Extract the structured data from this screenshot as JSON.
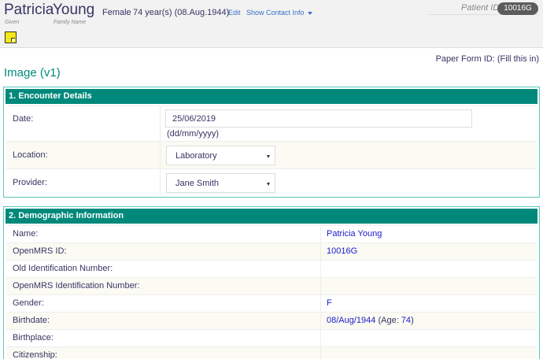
{
  "patient": {
    "given_name": "Patricia",
    "family_name": "Young",
    "given_label": "Given",
    "family_label": "Family Name",
    "gender": "Female",
    "age": "74 year(s) (08.Aug.1944)",
    "edit_label": "Edit",
    "contact_label": "Show Contact Info",
    "patient_id_label": "Patient ID",
    "patient_id": "10016G"
  },
  "form": {
    "paper_form_id": "Paper Form ID: (Fill this in)",
    "title": "Image (v1)"
  },
  "encounter": {
    "header": "1. Encounter Details",
    "date_label": "Date:",
    "date_value": "25/06/2019",
    "date_hint": "(dd/mm/yyyy)",
    "location_label": "Location:",
    "location_value": "Laboratory",
    "provider_label": "Provider:",
    "provider_value": "Jane Smith"
  },
  "demographics": {
    "header": "2. Demographic Information",
    "rows": [
      {
        "label": "Name:",
        "value": "Patricia Young"
      },
      {
        "label": "OpenMRS ID:",
        "value": "10016G"
      },
      {
        "label": "Old Identification Number:",
        "value": ""
      },
      {
        "label": "OpenMRS Identification Number:",
        "value": ""
      },
      {
        "label": "Gender:",
        "value": "F"
      },
      {
        "label": "Birthdate:",
        "value": "08/Aug/1944"
      },
      {
        "label": "Birthplace:",
        "value": ""
      },
      {
        "label": "Citizenship:",
        "value": ""
      }
    ],
    "age_prefix": "(Age:",
    "age_value": "74",
    "age_suffix": ")"
  },
  "colors": {
    "accent": "#00897b",
    "section_border": "#5ac8bc",
    "link": "#3a71c9",
    "value_text": "#1a1acc",
    "sticky_note": "#f4e817"
  }
}
